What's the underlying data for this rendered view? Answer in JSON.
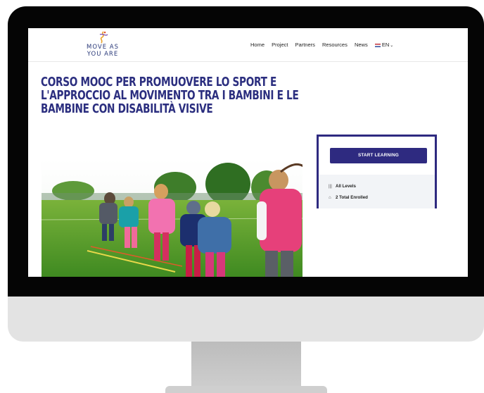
{
  "site": {
    "logo_line1": "MOVE AS",
    "logo_line2": "YOU ARE"
  },
  "nav": {
    "items": [
      "Home",
      "Project",
      "Partners",
      "Resources",
      "News"
    ],
    "language": "EN"
  },
  "course": {
    "title": "CORSO MOOC PER PROMUOVERE LO SPORT E L'APPROCCIO AL MOVIMENTO TRA I BAMBINI E LE BAMBINE CON DISABILITÀ VISIVE"
  },
  "card": {
    "start_label": "START LEARNING",
    "level": "All Levels",
    "enrolled": "2 Total Enrolled",
    "level_icon": "bars-icon",
    "enrolled_icon": "graduation-cap-icon"
  },
  "colors": {
    "brand": "#2e2a80",
    "title": "#2b2e7f"
  }
}
